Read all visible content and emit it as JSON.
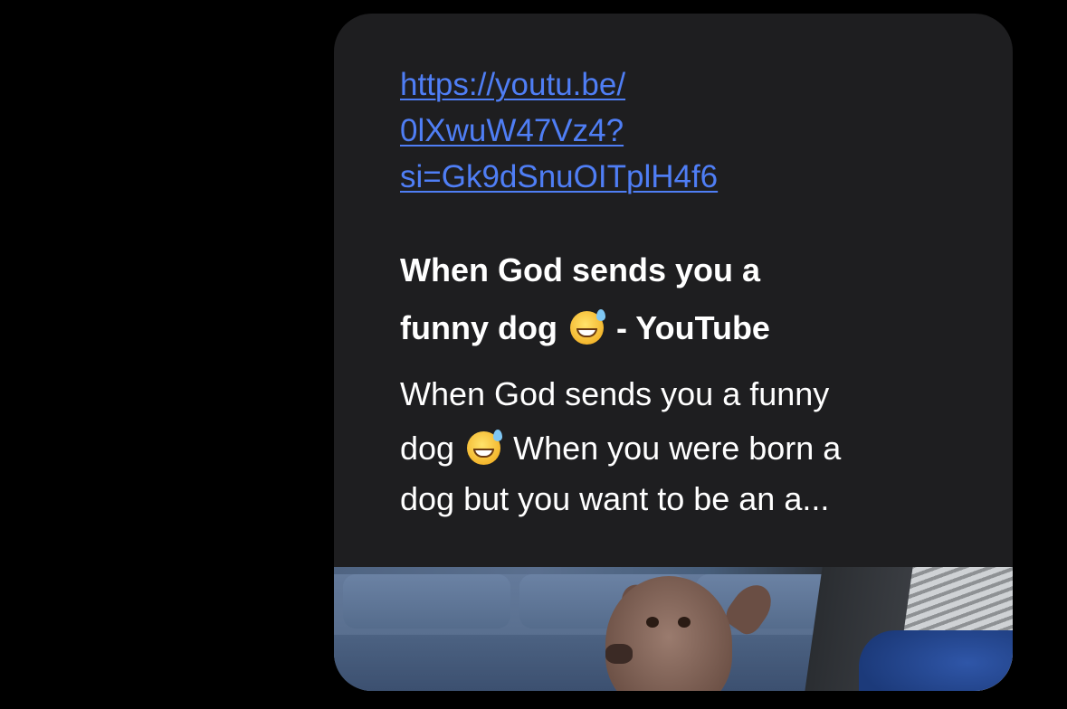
{
  "message": {
    "link_lines": [
      "https://youtu.be/",
      "0lXwuW47Vz4?",
      "si=Gk9dSnuOITplH4f6"
    ],
    "preview": {
      "title_line1": "When God sends you a",
      "title_line2_pre": "funny dog",
      "title_line2_post": " - YouTube",
      "desc_line1": "When God sends you a funny",
      "desc_line2_pre": "dog",
      "desc_line2_post": "When you were born a",
      "desc_line3": "dog but you want to be an a...",
      "emoji_icon": "grinning-face-with-sweat-emoji",
      "thumbnail_icon": "dog-on-sofa-thumbnail"
    }
  },
  "colors": {
    "background": "#000000",
    "bubble": "#1e1e20",
    "link": "#4f7ef5",
    "text": "#ffffff"
  }
}
